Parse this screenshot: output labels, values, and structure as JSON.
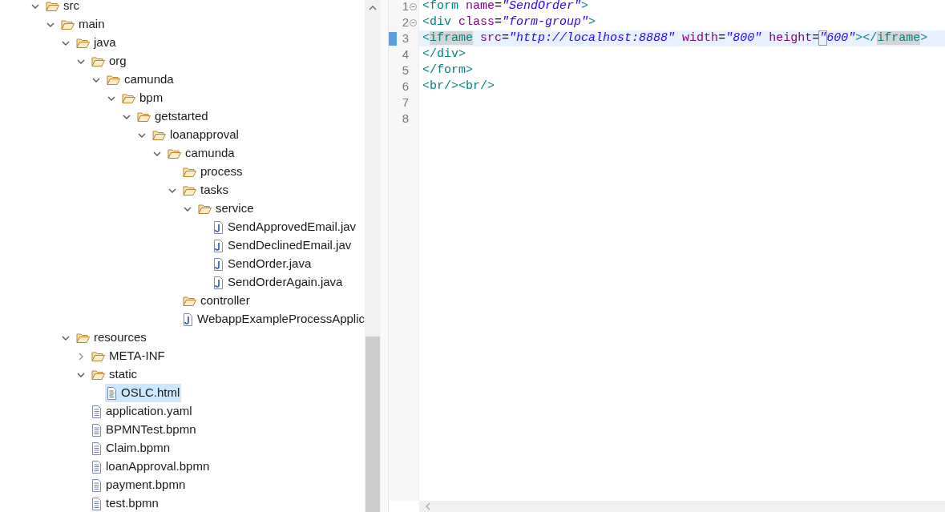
{
  "tree": [
    {
      "label": "src",
      "kind": "folder",
      "expanded": true,
      "selected": false,
      "children": [
        {
          "label": "main",
          "kind": "folder",
          "expanded": true,
          "selected": false,
          "children": [
            {
              "label": "java",
              "kind": "folder",
              "expanded": true,
              "selected": false,
              "children": [
                {
                  "label": "org",
                  "kind": "folder",
                  "expanded": true,
                  "selected": false,
                  "children": [
                    {
                      "label": "camunda",
                      "kind": "folder",
                      "expanded": true,
                      "selected": false,
                      "children": [
                        {
                          "label": "bpm",
                          "kind": "folder",
                          "expanded": true,
                          "selected": false,
                          "children": [
                            {
                              "label": "getstarted",
                              "kind": "folder",
                              "expanded": true,
                              "selected": false,
                              "children": [
                                {
                                  "label": "loanapproval",
                                  "kind": "folder",
                                  "expanded": true,
                                  "selected": false,
                                  "children": [
                                    {
                                      "label": "camunda",
                                      "kind": "folder",
                                      "expanded": true,
                                      "selected": false,
                                      "children": [
                                        {
                                          "label": "process",
                                          "kind": "empty-folder",
                                          "selected": false
                                        },
                                        {
                                          "label": "tasks",
                                          "kind": "folder",
                                          "expanded": true,
                                          "selected": false,
                                          "children": [
                                            {
                                              "label": "service",
                                              "kind": "folder",
                                              "expanded": true,
                                              "selected": false,
                                              "children": [
                                                {
                                                  "label": "SendApprovedEmail.jav",
                                                  "kind": "java",
                                                  "selected": false
                                                },
                                                {
                                                  "label": "SendDeclinedEmail.jav",
                                                  "kind": "java",
                                                  "selected": false
                                                },
                                                {
                                                  "label": "SendOrder.java",
                                                  "kind": "java",
                                                  "selected": false
                                                },
                                                {
                                                  "label": "SendOrderAgain.java",
                                                  "kind": "java",
                                                  "selected": false
                                                }
                                              ]
                                            }
                                          ]
                                        },
                                        {
                                          "label": "controller",
                                          "kind": "empty-folder",
                                          "selected": false
                                        },
                                        {
                                          "label": "WebappExampleProcessApplic",
                                          "kind": "java",
                                          "selected": false
                                        }
                                      ]
                                    }
                                  ]
                                }
                              ]
                            }
                          ]
                        }
                      ]
                    }
                  ]
                }
              ]
            },
            {
              "label": "resources",
              "kind": "folder",
              "expanded": true,
              "selected": false,
              "children": [
                {
                  "label": "META-INF",
                  "kind": "folder",
                  "expanded": false,
                  "selected": false
                },
                {
                  "label": "static",
                  "kind": "folder",
                  "expanded": true,
                  "selected": false,
                  "children": [
                    {
                      "label": "OSLC.html",
                      "kind": "html",
                      "selected": true
                    }
                  ]
                },
                {
                  "label": "application.yaml",
                  "kind": "text",
                  "selected": false
                },
                {
                  "label": "BPMNTest.bpmn",
                  "kind": "text",
                  "selected": false
                },
                {
                  "label": "Claim.bpmn",
                  "kind": "text",
                  "selected": false
                },
                {
                  "label": "loanApproval.bpmn",
                  "kind": "text",
                  "selected": false
                },
                {
                  "label": "payment.bpmn",
                  "kind": "text",
                  "selected": false
                },
                {
                  "label": "test.bpmn",
                  "kind": "text",
                  "selected": false
                }
              ]
            }
          ]
        }
      ]
    }
  ],
  "editor": {
    "lines": [
      {
        "number": "1",
        "fold": true,
        "current": false,
        "tokens": [
          {
            "kind": "tag",
            "text": "<form"
          },
          {
            "kind": "attr",
            "text": " name"
          },
          {
            "kind": "plain",
            "text": "="
          },
          {
            "kind": "value",
            "text": "\"SendOrder\""
          },
          {
            "kind": "tag",
            "text": ">"
          }
        ]
      },
      {
        "number": "2",
        "fold": true,
        "current": false,
        "tokens": [
          {
            "kind": "tag",
            "text": "<div"
          },
          {
            "kind": "attr",
            "text": " class"
          },
          {
            "kind": "plain",
            "text": "="
          },
          {
            "kind": "value",
            "text": "\"form-group\""
          },
          {
            "kind": "tag",
            "text": ">"
          }
        ]
      },
      {
        "number": "3",
        "fold": false,
        "current": true,
        "tokens": [
          {
            "kind": "tag",
            "text": "<"
          },
          {
            "kind": "match",
            "text": "iframe"
          },
          {
            "kind": "attr",
            "text": " src"
          },
          {
            "kind": "plain",
            "text": "="
          },
          {
            "kind": "value",
            "text": "\"http://localhost:8888\""
          },
          {
            "kind": "attr",
            "text": " width"
          },
          {
            "kind": "plain",
            "text": "="
          },
          {
            "kind": "value",
            "text": "\"800\""
          },
          {
            "kind": "attr",
            "text": " height"
          },
          {
            "kind": "plain",
            "text": "="
          },
          {
            "kind": "boxed",
            "text": "\""
          },
          {
            "kind": "value",
            "text": "600\""
          },
          {
            "kind": "tag",
            "text": "></"
          },
          {
            "kind": "match",
            "text": "iframe"
          },
          {
            "kind": "tag",
            "text": ">"
          }
        ]
      },
      {
        "number": "4",
        "fold": false,
        "current": false,
        "tokens": [
          {
            "kind": "tag",
            "text": "</div>"
          }
        ]
      },
      {
        "number": "5",
        "fold": false,
        "current": false,
        "tokens": [
          {
            "kind": "tag",
            "text": "</form>"
          }
        ]
      },
      {
        "number": "6",
        "fold": false,
        "current": false,
        "tokens": [
          {
            "kind": "tag",
            "text": "<br/><br/>"
          }
        ]
      },
      {
        "number": "7",
        "fold": false,
        "current": false
      },
      {
        "number": "8",
        "fold": false,
        "current": false
      }
    ]
  }
}
